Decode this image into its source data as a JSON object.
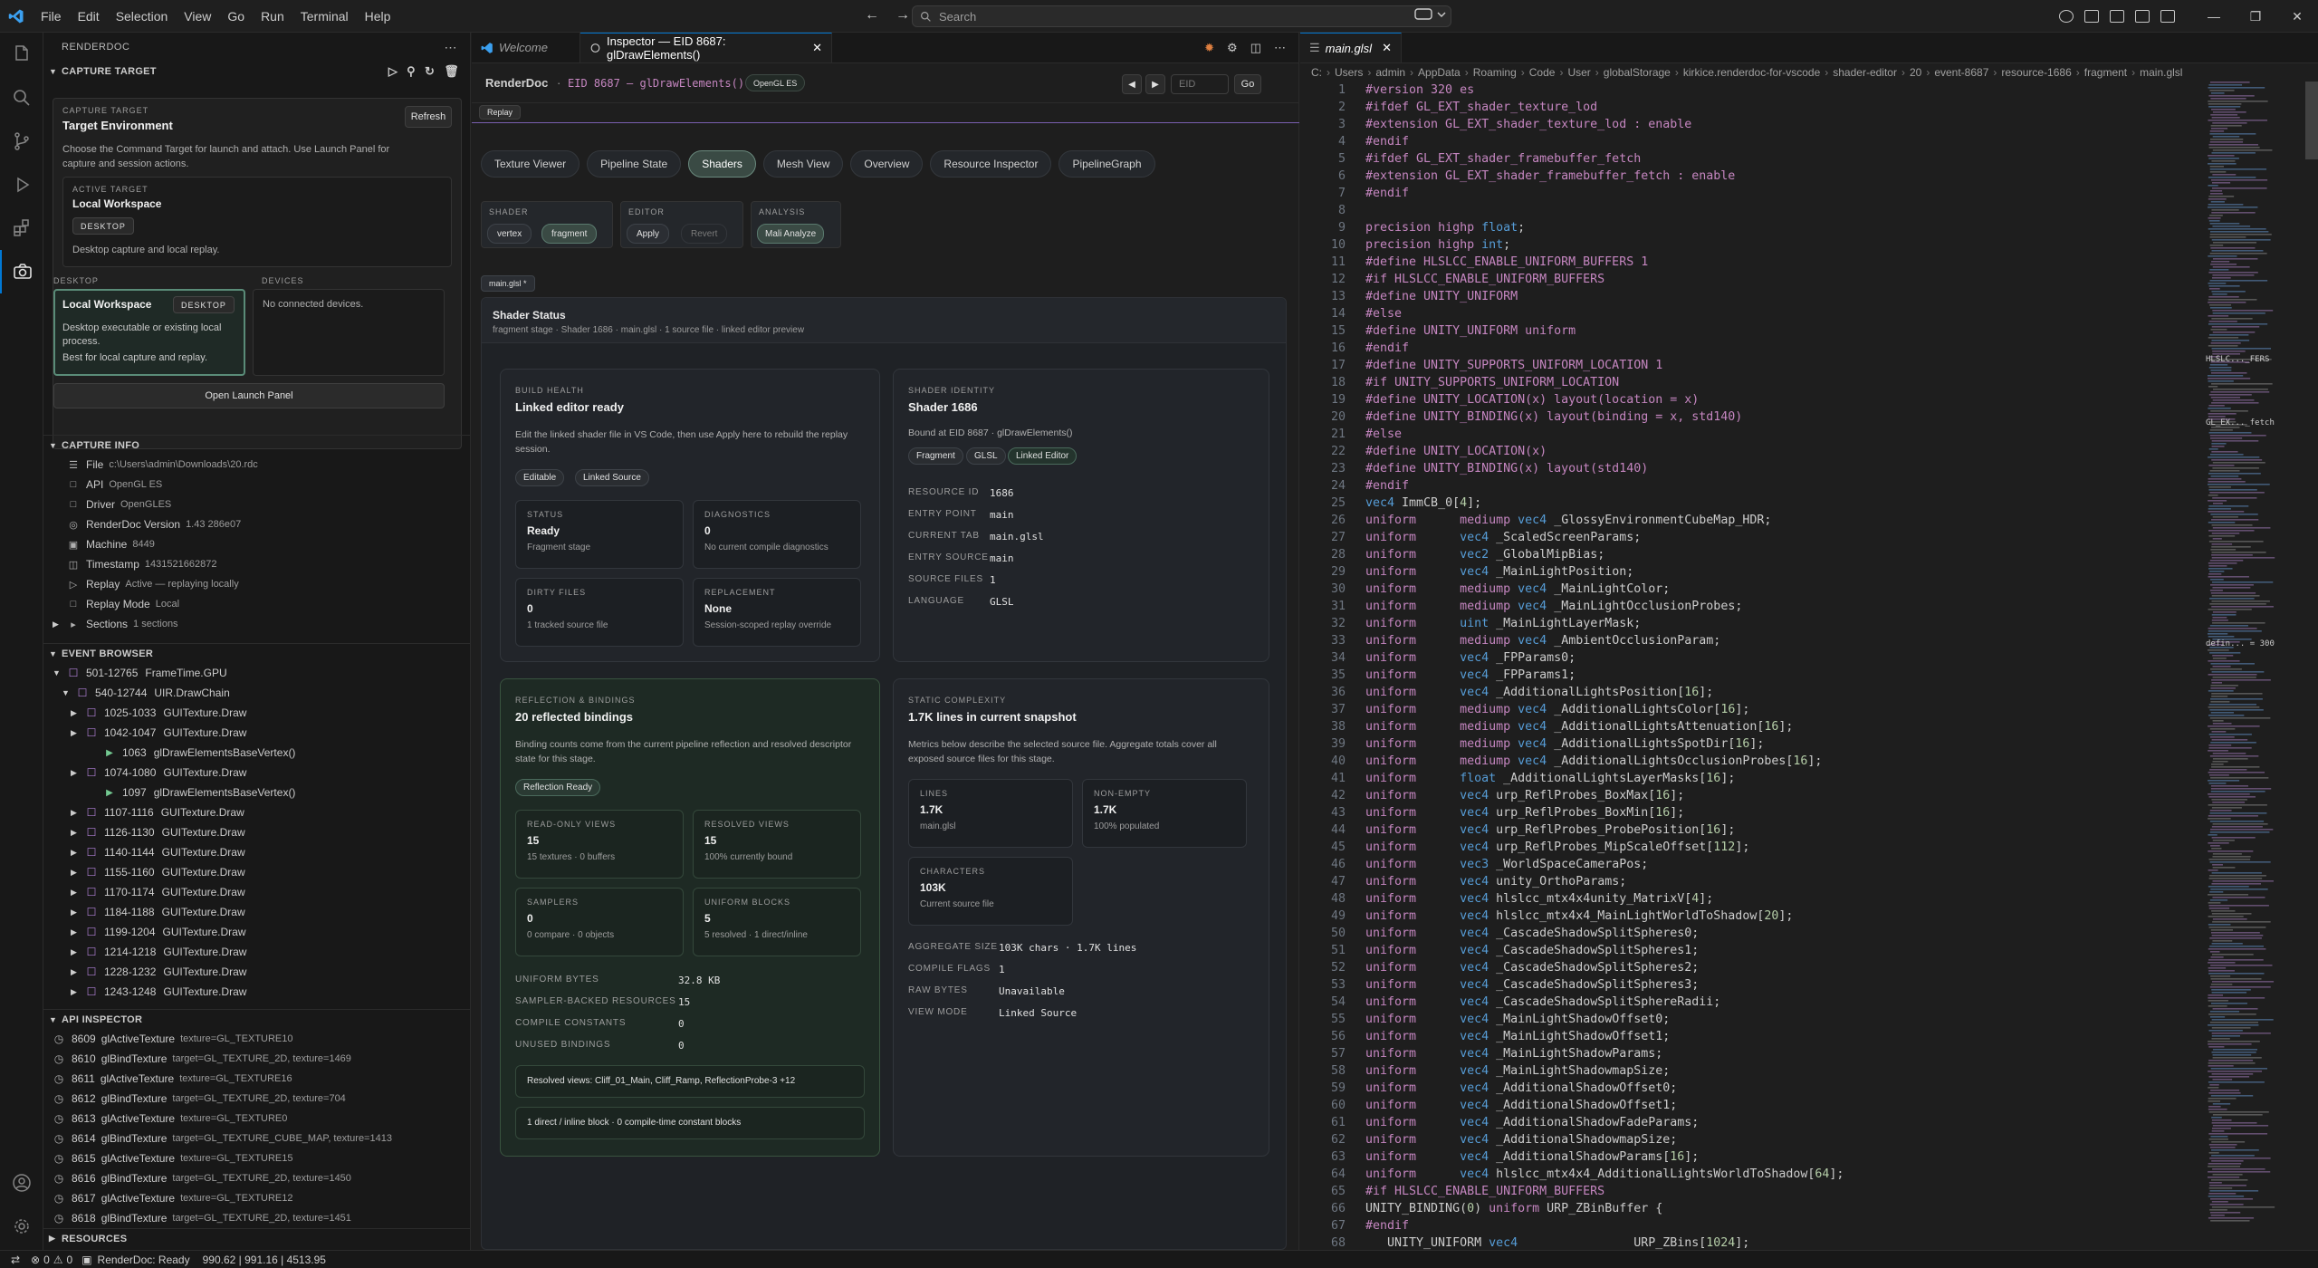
{
  "titlebar": {
    "menu": [
      "File",
      "Edit",
      "Selection",
      "View",
      "Go",
      "Run",
      "Terminal",
      "Help"
    ],
    "search_placeholder": "Search"
  },
  "sidebar": {
    "title": "RENDERDOC",
    "capture_target": {
      "header": "CAPTURE TARGET",
      "label": "CAPTURE TARGET",
      "title": "Target Environment",
      "refresh": "Refresh",
      "desc": "Choose the Command Target for launch and attach. Use Launch Panel for capture and session actions.",
      "active_label": "ACTIVE TARGET",
      "active_name": "Local Workspace",
      "active_badge": "DESKTOP",
      "active_desc": "Desktop capture and local replay.",
      "desktop_label": "DESKTOP",
      "devices_label": "DEVICES",
      "desktop_name": "Local Workspace",
      "desktop_badge": "DESKTOP",
      "desktop_desc": "Desktop executable or existing local process.",
      "desktop_desc2": "Best for local capture and replay.",
      "no_devices": "No connected devices.",
      "launch": "Open Launch Panel"
    },
    "capture_info": {
      "header": "CAPTURE INFO",
      "rows": [
        {
          "k": "File",
          "v": "c:\\Users\\admin\\Downloads\\20.rdc"
        },
        {
          "k": "API",
          "v": "OpenGL ES"
        },
        {
          "k": "Driver",
          "v": "OpenGLES"
        },
        {
          "k": "RenderDoc Version",
          "v": "1.43 286e07"
        },
        {
          "k": "Machine",
          "v": "8449"
        },
        {
          "k": "Timestamp",
          "v": "1431521662872"
        },
        {
          "k": "Replay",
          "v": "Active — replaying locally"
        },
        {
          "k": "Replay Mode",
          "v": "Local"
        },
        {
          "k": "Sections",
          "v": "1 sections"
        }
      ]
    },
    "event_browser": {
      "header": "EVENT BROWSER",
      "items": [
        {
          "range": "501-12765",
          "name": "FrameTime.GPU"
        },
        {
          "range": "540-12744",
          "name": "UIR.DrawChain"
        },
        {
          "range": "1025-1033",
          "name": "GUITexture.Draw"
        },
        {
          "range": "1042-1047",
          "name": "GUITexture.Draw"
        },
        {
          "range": "1063",
          "name": "glDrawElementsBaseVertex()"
        },
        {
          "range": "1074-1080",
          "name": "GUITexture.Draw"
        },
        {
          "range": "1097",
          "name": "glDrawElementsBaseVertex()"
        },
        {
          "range": "1107-1116",
          "name": "GUITexture.Draw"
        },
        {
          "range": "1126-1130",
          "name": "GUITexture.Draw"
        },
        {
          "range": "1140-1144",
          "name": "GUITexture.Draw"
        },
        {
          "range": "1155-1160",
          "name": "GUITexture.Draw"
        },
        {
          "range": "1170-1174",
          "name": "GUITexture.Draw"
        },
        {
          "range": "1184-1188",
          "name": "GUITexture.Draw"
        },
        {
          "range": "1199-1204",
          "name": "GUITexture.Draw"
        },
        {
          "range": "1214-1218",
          "name": "GUITexture.Draw"
        },
        {
          "range": "1228-1232",
          "name": "GUITexture.Draw"
        },
        {
          "range": "1243-1248",
          "name": "GUITexture.Draw"
        }
      ]
    },
    "api_inspector": {
      "header": "API INSPECTOR",
      "items": [
        {
          "id": "8609",
          "fn": "glActiveTexture",
          "args": "texture=GL_TEXTURE10"
        },
        {
          "id": "8610",
          "fn": "glBindTexture",
          "args": "target=GL_TEXTURE_2D, texture=1469"
        },
        {
          "id": "8611",
          "fn": "glActiveTexture",
          "args": "texture=GL_TEXTURE16"
        },
        {
          "id": "8612",
          "fn": "glBindTexture",
          "args": "target=GL_TEXTURE_2D, texture=704"
        },
        {
          "id": "8613",
          "fn": "glActiveTexture",
          "args": "texture=GL_TEXTURE0"
        },
        {
          "id": "8614",
          "fn": "glBindTexture",
          "args": "target=GL_TEXTURE_CUBE_MAP, texture=1413"
        },
        {
          "id": "8615",
          "fn": "glActiveTexture",
          "args": "texture=GL_TEXTURE15"
        },
        {
          "id": "8616",
          "fn": "glBindTexture",
          "args": "target=GL_TEXTURE_2D, texture=1450"
        },
        {
          "id": "8617",
          "fn": "glActiveTexture",
          "args": "texture=GL_TEXTURE12"
        },
        {
          "id": "8618",
          "fn": "glBindTexture",
          "args": "target=GL_TEXTURE_2D, texture=1451"
        }
      ]
    },
    "resources_header": "RESOURCES"
  },
  "editor1": {
    "tabs": [
      {
        "label": "Welcome"
      },
      {
        "label": "Inspector — EID 8687: glDrawElements()"
      }
    ],
    "brand": "RenderDoc",
    "eid_title": "EID 8687 — glDrawElements()",
    "api_badge": "OpenGL ES",
    "eid_placeholder": "EID",
    "go": "Go",
    "replay_badge": "Replay",
    "nav_tabs": [
      "Texture Viewer",
      "Pipeline State",
      "Shaders",
      "Mesh View",
      "Overview",
      "Resource Inspector",
      "PipelineGraph"
    ],
    "groups": {
      "shader_label": "SHADER",
      "vertex": "vertex",
      "fragment": "fragment",
      "editor_label": "EDITOR",
      "apply": "Apply",
      "revert": "Revert",
      "analysis_label": "ANALYSIS",
      "mali": "Mali Analyze"
    },
    "file_chip": "main.glsl *",
    "status": {
      "title": "Shader Status",
      "sub": "fragment stage · Shader 1686 · main.glsl · 1 source file · linked editor preview"
    },
    "build": {
      "label": "BUILD HEALTH",
      "title": "Linked editor ready",
      "desc": "Edit the linked shader file in VS Code, then use Apply here to rebuild the replay session.",
      "pills": [
        "Editable",
        "Linked Source"
      ],
      "cards": [
        {
          "k": "STATUS",
          "v": "Ready",
          "s": "Fragment stage"
        },
        {
          "k": "DIAGNOSTICS",
          "v": "0",
          "s": "No current compile diagnostics"
        },
        {
          "k": "DIRTY FILES",
          "v": "0",
          "s": "1 tracked source file"
        },
        {
          "k": "REPLACEMENT",
          "v": "None",
          "s": "Session-scoped replay override"
        }
      ]
    },
    "identity": {
      "label": "SHADER IDENTITY",
      "title": "Shader 1686",
      "desc": "Bound at EID 8687 · glDrawElements()",
      "pills": [
        "Fragment",
        "GLSL",
        "Linked Editor"
      ],
      "rows": [
        {
          "k": "RESOURCE ID",
          "v": "1686"
        },
        {
          "k": "ENTRY POINT",
          "v": "main"
        },
        {
          "k": "CURRENT TAB",
          "v": "main.glsl"
        },
        {
          "k": "ENTRY SOURCE",
          "v": "main"
        },
        {
          "k": "SOURCE FILES",
          "v": "1"
        },
        {
          "k": "LANGUAGE",
          "v": "GLSL"
        }
      ]
    },
    "reflection": {
      "label": "REFLECTION & BINDINGS",
      "title": "20 reflected bindings",
      "desc": "Binding counts come from the current pipeline reflection and resolved descriptor state for this stage.",
      "pill": "Reflection Ready",
      "cards": [
        {
          "k": "READ-ONLY VIEWS",
          "v": "15",
          "s": "15 textures · 0 buffers"
        },
        {
          "k": "RESOLVED VIEWS",
          "v": "15",
          "s": "100% currently bound"
        },
        {
          "k": "SAMPLERS",
          "v": "0",
          "s": "0 compare · 0 objects"
        },
        {
          "k": "UNIFORM BLOCKS",
          "v": "5",
          "s": "5 resolved · 1 direct/inline"
        }
      ],
      "rows": [
        {
          "k": "UNIFORM BYTES",
          "v": "32.8 KB"
        },
        {
          "k": "SAMPLER-BACKED RESOURCES",
          "v": "15"
        },
        {
          "k": "COMPILE CONSTANTS",
          "v": "0"
        },
        {
          "k": "UNUSED BINDINGS",
          "v": "0"
        }
      ],
      "resolved": "Resolved views: Cliff_01_Main, Cliff_Ramp, ReflectionProbe-3 +12",
      "blocks": "1 direct / inline block · 0 compile-time constant blocks"
    },
    "complexity": {
      "label": "STATIC COMPLEXITY",
      "title": "1.7K lines in current snapshot",
      "desc": "Metrics below describe the selected source file. Aggregate totals cover all exposed source files for this stage.",
      "cards": [
        {
          "k": "LINES",
          "v": "1.7K",
          "s": "main.glsl"
        },
        {
          "k": "NON-EMPTY",
          "v": "1.7K",
          "s": "100% populated"
        },
        {
          "k": "CHARACTERS",
          "v": "103K",
          "s": "Current source file"
        }
      ],
      "rows": [
        {
          "k": "AGGREGATE SIZE",
          "v": "103K chars · 1.7K lines"
        },
        {
          "k": "COMPILE FLAGS",
          "v": "1"
        },
        {
          "k": "RAW BYTES",
          "v": "Unavailable"
        },
        {
          "k": "VIEW MODE",
          "v": "Linked Source"
        }
      ]
    }
  },
  "editor2": {
    "tab": "main.glsl",
    "breadcrumb": [
      "C:",
      "Users",
      "admin",
      "AppData",
      "Roaming",
      "Code",
      "User",
      "globalStorage",
      "kirkice.renderdoc-for-vscode",
      "shader-editor",
      "20",
      "event-8687",
      "resource-1686",
      "fragment",
      "main.glsl"
    ],
    "lines": [
      "#version 320 es",
      "#ifdef GL_EXT_shader_texture_lod",
      "#extension GL_EXT_shader_texture_lod : enable",
      "#endif",
      "#ifdef GL_EXT_shader_framebuffer_fetch",
      "#extension GL_EXT_shader_framebuffer_fetch : enable",
      "#endif",
      "",
      "precision highp float;",
      "precision highp int;",
      "#define HLSLCC_ENABLE_UNIFORM_BUFFERS 1",
      "#if HLSLCC_ENABLE_UNIFORM_BUFFERS",
      "#define UNITY_UNIFORM",
      "#else",
      "#define UNITY_UNIFORM uniform",
      "#endif",
      "#define UNITY_SUPPORTS_UNIFORM_LOCATION 1",
      "#if UNITY_SUPPORTS_UNIFORM_LOCATION",
      "#define UNITY_LOCATION(x) layout(location = x)",
      "#define UNITY_BINDING(x) layout(binding = x, std140)",
      "#else",
      "#define UNITY_LOCATION(x)",
      "#define UNITY_BINDING(x) layout(std140)",
      "#endif",
      "vec4 ImmCB_0[4];",
      "uniform \t mediump vec4 _GlossyEnvironmentCubeMap_HDR;",
      "uniform \t vec4 _ScaledScreenParams;",
      "uniform \t vec2 _GlobalMipBias;",
      "uniform \t vec4 _MainLightPosition;",
      "uniform \t mediump vec4 _MainLightColor;",
      "uniform \t mediump vec4 _MainLightOcclusionProbes;",
      "uniform \t uint _MainLightLayerMask;",
      "uniform \t mediump vec4 _AmbientOcclusionParam;",
      "uniform \t vec4 _FPParams0;",
      "uniform \t vec4 _FPParams1;",
      "uniform \t vec4 _AdditionalLightsPosition[16];",
      "uniform \t mediump vec4 _AdditionalLightsColor[16];",
      "uniform \t mediump vec4 _AdditionalLightsAttenuation[16];",
      "uniform \t mediump vec4 _AdditionalLightsSpotDir[16];",
      "uniform \t mediump vec4 _AdditionalLightsOcclusionProbes[16];",
      "uniform \t float _AdditionalLightsLayerMasks[16];",
      "uniform \t vec4 urp_ReflProbes_BoxMax[16];",
      "uniform \t vec4 urp_ReflProbes_BoxMin[16];",
      "uniform \t vec4 urp_ReflProbes_ProbePosition[16];",
      "uniform \t vec4 urp_ReflProbes_MipScaleOffset[112];",
      "uniform \t vec3 _WorldSpaceCameraPos;",
      "uniform \t vec4 unity_OrthoParams;",
      "uniform \t vec4 hlslcc_mtx4x4unity_MatrixV[4];",
      "uniform \t vec4 hlslcc_mtx4x4_MainLightWorldToShadow[20];",
      "uniform \t vec4 _CascadeShadowSplitSpheres0;",
      "uniform \t vec4 _CascadeShadowSplitSpheres1;",
      "uniform \t vec4 _CascadeShadowSplitSpheres2;",
      "uniform \t vec4 _CascadeShadowSplitSpheres3;",
      "uniform \t vec4 _CascadeShadowSplitSphereRadii;",
      "uniform \t vec4 _MainLightShadowOffset0;",
      "uniform \t vec4 _MainLightShadowOffset1;",
      "uniform \t vec4 _MainLightShadowParams;",
      "uniform \t vec4 _MainLightShadowmapSize;",
      "uniform \t vec4 _AdditionalShadowOffset0;",
      "uniform \t vec4 _AdditionalShadowOffset1;",
      "uniform \t vec4 _AdditionalShadowFadeParams;",
      "uniform \t vec4 _AdditionalShadowmapSize;",
      "uniform \t vec4 _AdditionalShadowParams[16];",
      "uniform \t vec4 hlslcc_mtx4x4_AdditionalLightsWorldToShadow[64];",
      "#if HLSLCC_ENABLE_UNIFORM_BUFFERS",
      "UNITY_BINDING(0) uniform URP_ZBinBuffer {",
      "#endif",
      "   UNITY_UNIFORM vec4                URP_ZBins[1024];"
    ],
    "minimap_labels": [
      "GL_EX..._fetch",
      "HLSLC..._FERS",
      "defin... = 300"
    ]
  },
  "statusbar": {
    "problems": "0 ⚠ 0",
    "errors": "0",
    "warnings": "0",
    "renderdoc": "RenderDoc: Ready",
    "coords": "990.62 | 991.16 | 4513.95"
  }
}
